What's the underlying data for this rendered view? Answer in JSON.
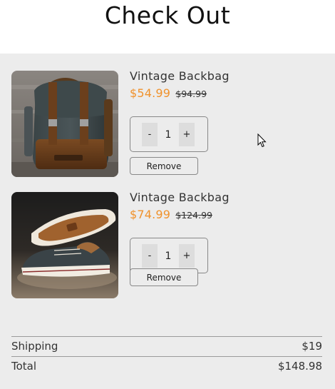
{
  "page": {
    "title": "Check Out"
  },
  "items": [
    {
      "name": "Vintage Backbag",
      "price": "$54.99",
      "old_price": "$94.99",
      "quantity": "1",
      "minus_label": "-",
      "plus_label": "+",
      "remove_label": "Remove",
      "image": "backpack-photo"
    },
    {
      "name": "Vintage Backbag",
      "price": "$74.99",
      "old_price": "$124.99",
      "quantity": "1",
      "minus_label": "-",
      "plus_label": "+",
      "remove_label": "Remove",
      "image": "sneaker-photo"
    }
  ],
  "summary": {
    "shipping_label": "Shipping",
    "shipping_value": "$19",
    "total_label": "Total",
    "total_value": "$148.98"
  },
  "colors": {
    "accent": "#f0922c",
    "panel": "#ececec"
  }
}
